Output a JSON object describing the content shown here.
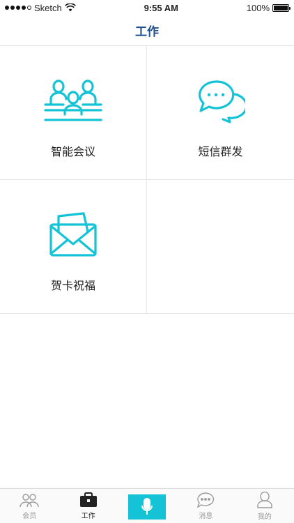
{
  "status": {
    "carrier": "Sketch",
    "time": "9:55 AM",
    "battery": "100%"
  },
  "nav": {
    "title": "工作"
  },
  "grid": [
    {
      "label": "智能会议",
      "icon": "meeting-people-icon"
    },
    {
      "label": "短信群发",
      "icon": "chat-bubbles-icon"
    },
    {
      "label": "贺卡祝福",
      "icon": "envelope-card-icon"
    }
  ],
  "tabs": [
    {
      "label": "会员",
      "icon": "members-icon",
      "active": false
    },
    {
      "label": "工作",
      "icon": "briefcase-icon",
      "active": true
    },
    {
      "label": "",
      "icon": "microphone-icon",
      "active": false
    },
    {
      "label": "消息",
      "icon": "message-bubble-icon",
      "active": false
    },
    {
      "label": "我的",
      "icon": "profile-icon",
      "active": false
    }
  ],
  "colors": {
    "accent": "#14c3d6",
    "title": "#1f4e8c"
  }
}
